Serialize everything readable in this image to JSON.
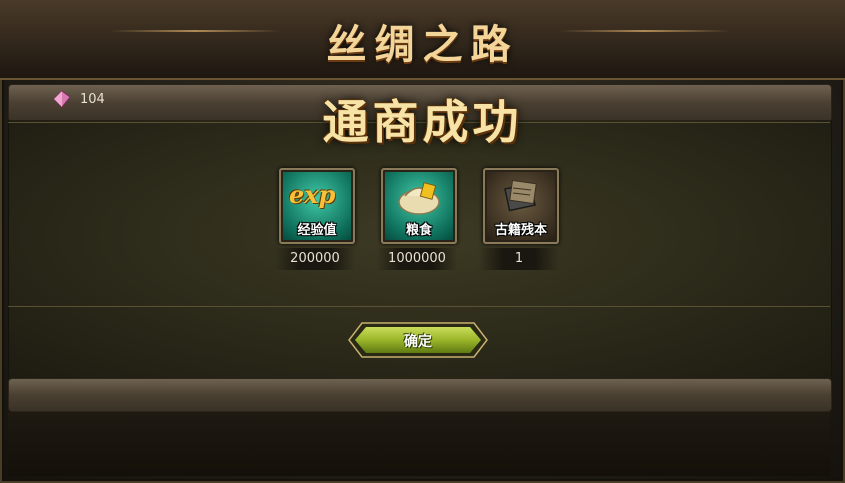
{
  "dialog": {
    "title": "丝绸之路",
    "banner": "通商成功",
    "confirm_label": "确定"
  },
  "currency": {
    "icon": "pink-gem-icon",
    "count": "104"
  },
  "rewards": [
    {
      "icon": "exp-icon",
      "icon_text": "exp",
      "label": "经验值",
      "quantity": "200000"
    },
    {
      "icon": "grain-sack-icon",
      "label": "粮食",
      "quantity": "1000000"
    },
    {
      "icon": "ancient-book-icon",
      "label": "古籍残本",
      "quantity": "1"
    }
  ],
  "colors": {
    "title": "#f3d59a",
    "item_bg": "#0e6e5a",
    "button": "#9bb62a"
  }
}
